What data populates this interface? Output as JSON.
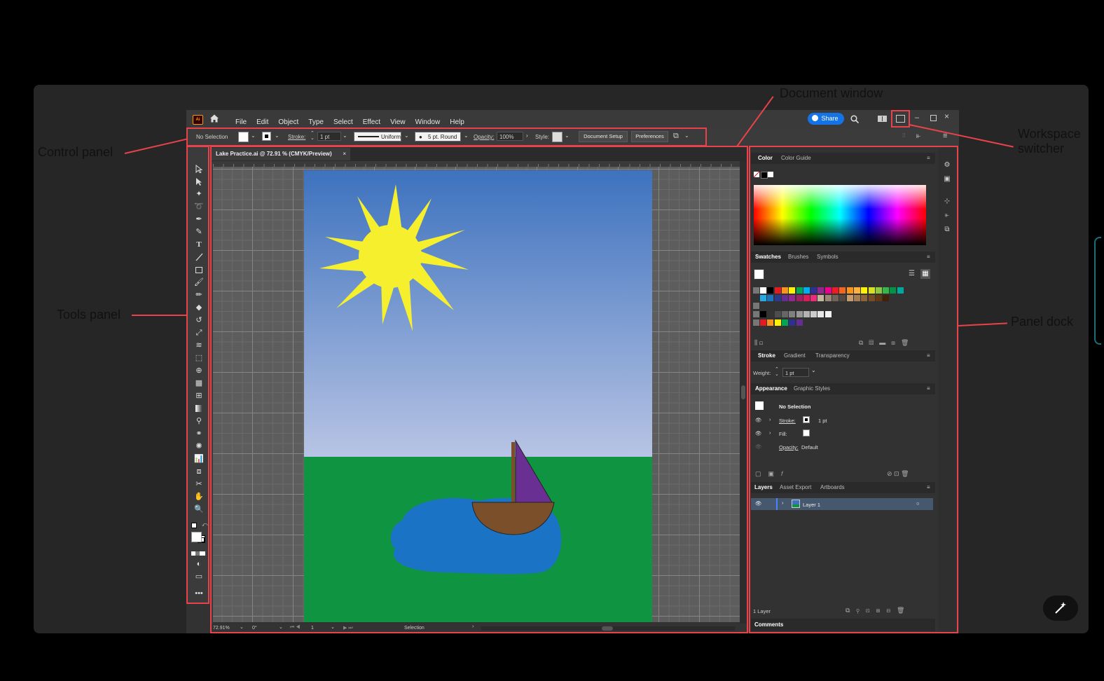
{
  "annotations": {
    "control_panel": "Control panel",
    "tools_panel": "Tools panel",
    "document_window": "Document window",
    "workspace_switcher": "Workspace\nswitcher",
    "panel_dock": "Panel dock"
  },
  "app": {
    "logo": "Ai",
    "menu": [
      "File",
      "Edit",
      "Object",
      "Type",
      "Select",
      "Effect",
      "View",
      "Window",
      "Help"
    ],
    "share_label": "Share"
  },
  "control": {
    "selection": "No Selection",
    "stroke_label": "Stroke:",
    "stroke_value": "1 pt",
    "profile": "Uniform",
    "brush": "5 pt. Round",
    "opacity_label": "Opacity:",
    "opacity_value": "100%",
    "style_label": "Style:",
    "document_setup": "Document Setup",
    "preferences": "Preferences"
  },
  "document": {
    "tab_title": "Lake Practice.ai @ 72.91 % (CMYK/Preview)",
    "zoom": "72.91%",
    "rotation": "0°",
    "artboard_num": "1",
    "status_tool": "Selection"
  },
  "panels": {
    "color_tabs": [
      "Color",
      "Color Guide"
    ],
    "swatch_tabs": [
      "Swatches",
      "Brushes",
      "Symbols"
    ],
    "stroke_tabs": [
      "Stroke",
      "Gradient",
      "Transparency"
    ],
    "weight_label": "Weight:",
    "weight_value": "1 pt",
    "appearance_tabs": [
      "Appearance",
      "Graphic Styles"
    ],
    "appearance_title": "No Selection",
    "appearance_rows": [
      {
        "label": "Stroke:",
        "value": "1 pt"
      },
      {
        "label": "Fill:",
        "value": ""
      },
      {
        "label": "Opacity:",
        "value": "Default"
      }
    ],
    "layers_tabs": [
      "Layers",
      "Asset Export",
      "Artboards"
    ],
    "layer_name": "Layer 1",
    "layers_count": "1 Layer",
    "comments": "Comments"
  },
  "colors": {
    "accent_red": "#e8424a",
    "sky_top": "#3d72be",
    "sky_bottom": "#b8c4e4",
    "grass": "#0f9542",
    "lake": "#1a73c4",
    "sun": "#f6ef2e",
    "boat": "#7b4f2a",
    "sail": "#6a2f93"
  },
  "swatches": {
    "row1": [
      "#fff",
      "#000",
      "#e21b23",
      "#f7941d",
      "#fff200",
      "#00a651",
      "#00aeef",
      "#2e3192",
      "#92278f",
      "#ec008c",
      "#ed1c24",
      "#f26522",
      "#f7941d",
      "#fbb040",
      "#fff200",
      "#d7df23",
      "#8dc63f",
      "#39b54a",
      "#009444",
      "#00a79d"
    ],
    "row2": [
      "#27aae1",
      "#1c75bc",
      "#2b3990",
      "#662d91",
      "#92278f",
      "#9e1f63",
      "#da1c5c",
      "#ee2a7b",
      "#c2b59b",
      "#998675",
      "#736357",
      "#534741",
      "#c69c6d",
      "#a67c52",
      "#8c6239",
      "#754c24",
      "#603913",
      "#42210b"
    ],
    "row4": [
      "#000",
      "#333",
      "#4d4d4d",
      "#666",
      "#808080",
      "#999",
      "#b3b3b3",
      "#ccc",
      "#e6e6e6",
      "#f2f2f2"
    ],
    "row5": [
      "#e21b23",
      "#f7941d",
      "#fff200",
      "#00a651",
      "#2e3192",
      "#662d91"
    ]
  }
}
